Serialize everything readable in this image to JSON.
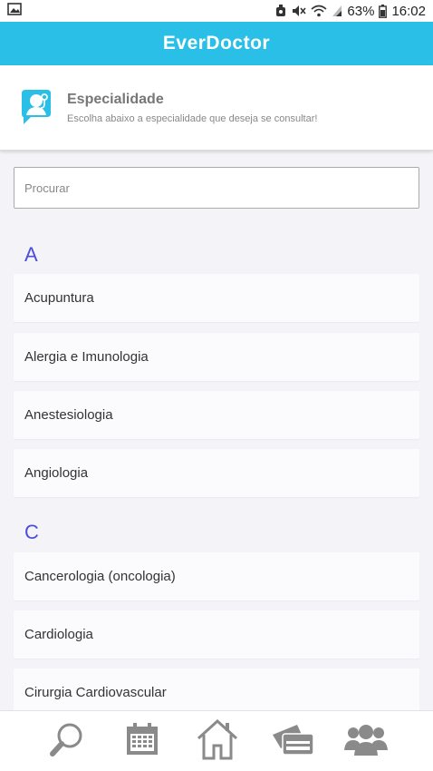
{
  "status_bar": {
    "battery": "63%",
    "time": "16:02",
    "icons": [
      "image-icon",
      "alarm-icon",
      "mute-icon",
      "wifi-icon",
      "signal-icon",
      "battery-icon"
    ]
  },
  "app_bar": {
    "title": "EverDoctor"
  },
  "header": {
    "icon": "doctor-chat-icon",
    "title": "Especialidade",
    "subtitle": "Escolha abaixo a especialidade que deseja se consultar!"
  },
  "search": {
    "placeholder": "Procurar",
    "value": ""
  },
  "sections": [
    {
      "letter": "A",
      "items": [
        "Acupuntura",
        "Alergia e Imunologia",
        "Anestesiologia",
        "Angiologia"
      ]
    },
    {
      "letter": "C",
      "items": [
        "Cancerologia (oncologia)",
        "Cardiologia",
        "Cirurgia Cardiovascular"
      ]
    }
  ],
  "bottom_nav": {
    "items": [
      {
        "name": "search",
        "icon": "search-icon"
      },
      {
        "name": "calendar",
        "icon": "calendar-icon"
      },
      {
        "name": "home",
        "icon": "home-icon"
      },
      {
        "name": "payment",
        "icon": "payment-cards-icon"
      },
      {
        "name": "users",
        "icon": "users-icon"
      }
    ]
  },
  "colors": {
    "app_bar": "#29bfe6",
    "letter_heading": "#4a4fd6",
    "nav_icon": "#8a8a8a"
  }
}
